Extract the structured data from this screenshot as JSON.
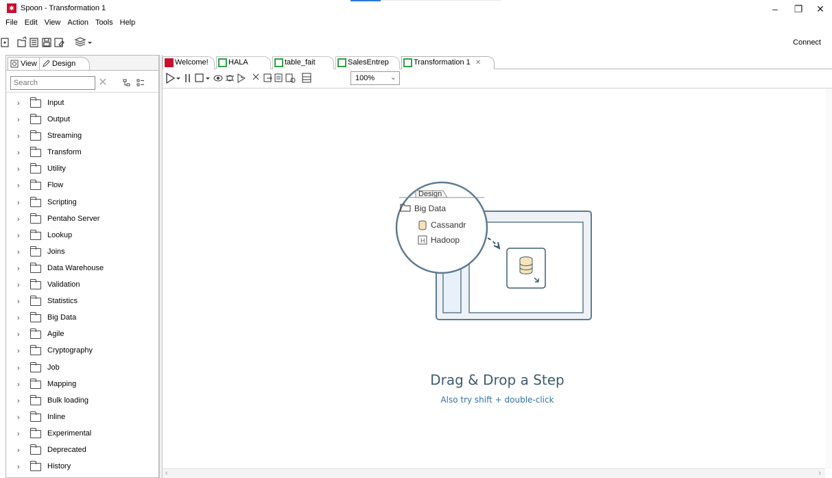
{
  "window": {
    "title": "Spoon - Transformation 1",
    "app_icon": "spoon-logo-icon",
    "minimize_glyph": "–",
    "restore_glyph": "❐",
    "close_glyph": "✕"
  },
  "menu": [
    "File",
    "Edit",
    "View",
    "Action",
    "Tools",
    "Help"
  ],
  "toolbar": {
    "connect_label": "Connect",
    "icons": [
      "new-file-icon",
      "open-folder-icon",
      "explore-repo-icon",
      "save-icon",
      "save-as-icon",
      "layers-icon"
    ]
  },
  "left_panel": {
    "tabs": {
      "view": "View",
      "design": "Design"
    },
    "search_placeholder": "Search",
    "folders": [
      "Input",
      "Output",
      "Streaming",
      "Transform",
      "Utility",
      "Flow",
      "Scripting",
      "Pentaho Server",
      "Lookup",
      "Joins",
      "Data Warehouse",
      "Validation",
      "Statistics",
      "Big Data",
      "Agile",
      "Cryptography",
      "Job",
      "Mapping",
      "Bulk loading",
      "Inline",
      "Experimental",
      "Deprecated",
      "History"
    ]
  },
  "file_tabs": [
    {
      "label": "Welcome!",
      "icon": "spoon-logo-icon"
    },
    {
      "label": "HALA",
      "icon": "transformation-icon"
    },
    {
      "label": "table_fait",
      "icon": "transformation-icon"
    },
    {
      "label": "SalesEntrep",
      "icon": "transformation-icon"
    },
    {
      "label": "Transformation 1",
      "icon": "transformation-icon",
      "active": true
    }
  ],
  "zoom": {
    "value": "100%"
  },
  "canvas": {
    "illustration": {
      "tab_label": "Design",
      "folder_label": "Big Data",
      "item1": "Cassandr",
      "item2": "Hadoop"
    },
    "hint_title": "Drag & Drop a Step",
    "hint_subtitle": "Also try shift + double-click"
  },
  "colors": {
    "accent_red": "#c8102e",
    "accent_green": "#2ea043",
    "hint_title": "#3d5c70",
    "hint_link": "#2f72a6"
  }
}
